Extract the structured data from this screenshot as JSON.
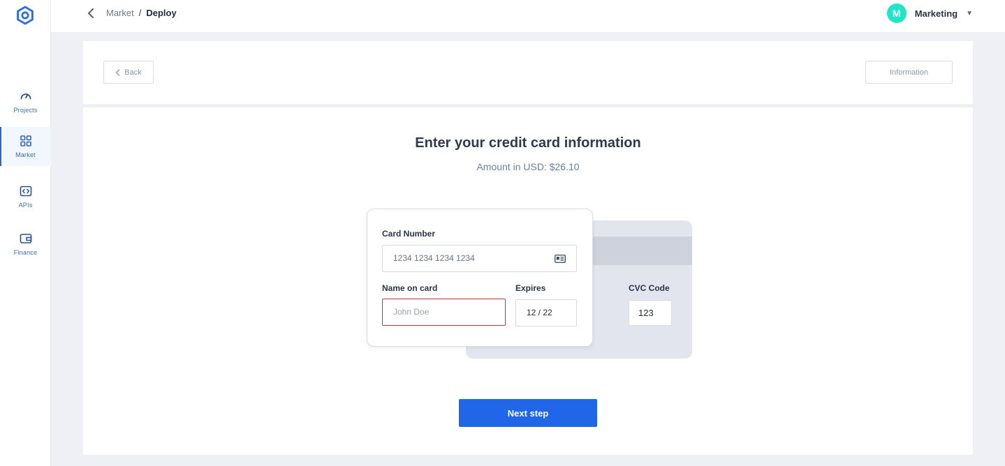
{
  "sidebar": {
    "logo_icon": "hexagon-eye-logo",
    "items": [
      {
        "label": "Projects",
        "icon": "speedometer-icon",
        "active": false
      },
      {
        "label": "Market",
        "icon": "grid-icon",
        "active": true
      },
      {
        "label": "APIs",
        "icon": "code-brackets-icon",
        "active": false
      },
      {
        "label": "Finance",
        "icon": "wallet-icon",
        "active": false
      }
    ]
  },
  "header": {
    "breadcrumb": {
      "parent": "Market",
      "separator": "/",
      "current": "Deploy"
    },
    "user": {
      "initial": "M",
      "name": "Marketing",
      "avatar_color": "#1ee6c7"
    }
  },
  "toolbar": {
    "back_label": "Back",
    "info_label": "Information"
  },
  "payment": {
    "title": "Enter your credit card information",
    "amount_text": "Amount in USD: $26.10",
    "card_number": {
      "label": "Card Number",
      "placeholder": "1234 1234 1234 1234"
    },
    "name_on_card": {
      "label": "Name on card",
      "placeholder": "John Doe",
      "state": "error"
    },
    "expires": {
      "label": "Expires",
      "value": "12 / 22"
    },
    "cvc": {
      "label": "CVC Code",
      "value": "123"
    },
    "next_label": "Next step"
  },
  "colors": {
    "accent": "#2166e8",
    "nav_active": "#2e64c4",
    "error_border": "#c8323c",
    "page_bg": "#eef0f5"
  }
}
